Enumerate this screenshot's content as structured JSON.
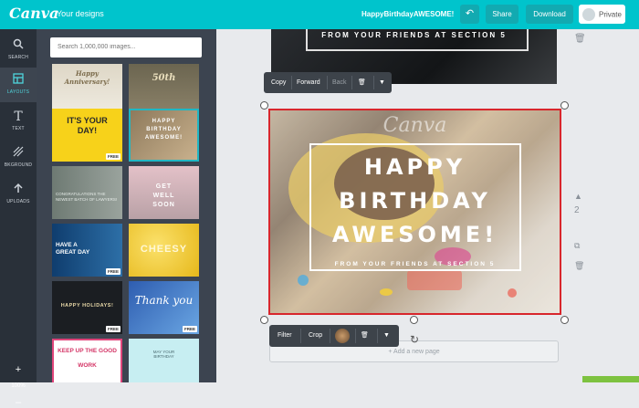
{
  "topbar": {
    "logo": "Canva",
    "your_designs": "Your designs",
    "design_title": "HappyBirthdayAWESOME!",
    "undo_label": "↶",
    "share_label": "Share",
    "download_label": "Download",
    "private_label": "Private"
  },
  "sidebar": {
    "items": [
      {
        "label": "SEARCH",
        "icon": "search-icon"
      },
      {
        "label": "LAYOUTS",
        "icon": "layouts-icon"
      },
      {
        "label": "TEXT",
        "icon": "text-icon"
      },
      {
        "label": "BKGROUND",
        "icon": "background-icon"
      },
      {
        "label": "UPLOADS",
        "icon": "uploads-icon"
      }
    ],
    "zoom_in": "+",
    "zoom_level": "100%",
    "zoom_out": "–"
  },
  "panel": {
    "search_placeholder": "Search 1,000,000 images...",
    "free_badge": "FREE",
    "thumbs": [
      {
        "text": "Happy Anniversary!"
      },
      {
        "text": "50th"
      },
      {
        "text": "IT'S YOUR DAY!",
        "free": true
      },
      {
        "text": "HAPPY BIRTHDAY AWESOME!"
      },
      {
        "text": "CONGRATULATIONS THE NEWEST BATCH OF LAWYERS!"
      },
      {
        "text": "GET WELL SOON"
      },
      {
        "text": "HAVE A GREAT DAY",
        "free": true
      },
      {
        "text": "CHEESY"
      },
      {
        "text": "HAPPY HOLIDAYS!",
        "free": true
      },
      {
        "text": "Thank you",
        "free": true
      },
      {
        "text": "KEEP UP THE GOOD WORK"
      },
      {
        "text": "MAY YOUR BIRTHDAY"
      }
    ]
  },
  "canvas": {
    "page1_text": "FROM YOUR FRIENDS AT SECTION 5",
    "toolbar_top": {
      "copy": "Copy",
      "forward": "Forward",
      "back": "Back"
    },
    "watermark": "Canva",
    "headline": [
      "HAPPY",
      "BIRTHDAY",
      "AWESOME!"
    ],
    "subline": "FROM YOUR FRIENDS AT SECTION 5",
    "page_number": "2",
    "toolbar_bottom": {
      "filter": "Filter",
      "crop": "Crop"
    },
    "add_page": "+ Add a new page"
  },
  "colors": {
    "accent": "#00c4cc",
    "sidebar": "#293039",
    "panel": "#3c4450",
    "selection": "#d8262c"
  }
}
